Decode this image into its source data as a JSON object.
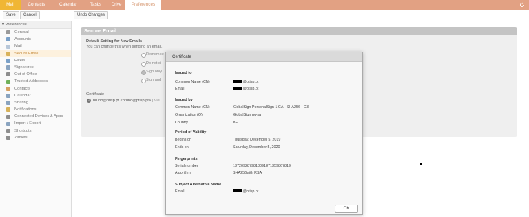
{
  "tabs": [
    {
      "label": "Mail"
    },
    {
      "label": "Contacts"
    },
    {
      "label": "Calendar"
    },
    {
      "label": "Tasks"
    },
    {
      "label": "Drive"
    },
    {
      "label": "Preferences"
    }
  ],
  "toolbar": {
    "save_label": "Save",
    "cancel_label": "Cancel",
    "undo_label": "Undo Changes"
  },
  "sidebar": {
    "header": "Preferences",
    "items": [
      {
        "label": "General",
        "icon": "gear-icon",
        "color": "#9a9a9a"
      },
      {
        "label": "Accounts",
        "icon": "accounts-icon",
        "color": "#7aa0c8"
      },
      {
        "label": "Mail",
        "icon": "mail-icon",
        "color": "#b7c7d9"
      },
      {
        "label": "Secure Email",
        "icon": "secure-email-icon",
        "color": "#d9b25a"
      },
      {
        "label": "Filters",
        "icon": "filters-icon",
        "color": "#7aa0c8"
      },
      {
        "label": "Signatures",
        "icon": "signatures-icon",
        "color": "#8aa4c0"
      },
      {
        "label": "Out of Office",
        "icon": "out-of-office-icon",
        "color": "#8e8e8e"
      },
      {
        "label": "Trusted Addresses",
        "icon": "trusted-addresses-icon",
        "color": "#6fb05a"
      },
      {
        "label": "Contacts",
        "icon": "contacts-icon",
        "color": "#d7a163"
      },
      {
        "label": "Calendar",
        "icon": "calendar-icon",
        "color": "#8aa4c0"
      },
      {
        "label": "Sharing",
        "icon": "sharing-icon",
        "color": "#8aa4c0"
      },
      {
        "label": "Notifications",
        "icon": "notifications-icon",
        "color": "#d7b25a"
      },
      {
        "label": "Connected Devices & Apps",
        "icon": "devices-icon",
        "color": "#8e8e8e"
      },
      {
        "label": "Import / Export",
        "icon": "import-export-icon",
        "color": "#8aa4c0"
      },
      {
        "label": "Shortcuts",
        "icon": "shortcuts-icon",
        "color": "#8e8e8e"
      },
      {
        "label": "Zimlets",
        "icon": "zimlets-icon",
        "color": "#8e8e8e"
      }
    ]
  },
  "secure_email": {
    "title": "Secure Email",
    "default_heading": "Default Setting for New Emails",
    "default_desc": "You can change this when sending an email.",
    "options": [
      {
        "label": "Remembe"
      },
      {
        "label": "Do not si"
      },
      {
        "label": "Sign only"
      },
      {
        "label": "Sign and"
      }
    ],
    "certificate_label": "Certificate",
    "certificate_value": "bruno@ptisp.pt <bruno@ptisp.pt>",
    "view_link": "| Vie"
  },
  "dialog": {
    "title": "Certificate",
    "issued_to": {
      "heading": "Issued to",
      "cn_label": "Common Name (CN)",
      "cn_value": "@ptisp.pt",
      "email_label": "Email",
      "email_value": "@ptisp.pt"
    },
    "issued_by": {
      "heading": "Issued by",
      "cn_label": "Common Name (CN)",
      "cn_value": "GlobalSign PersonalSign 1 CA - SHA256 - G3",
      "org_label": "Organization (O)",
      "org_value": "GlobalSign nv-sa",
      "country_label": "Country",
      "country_value": "BE"
    },
    "validity": {
      "heading": "Period of Validity",
      "begins_label": "Begins on",
      "begins_value": "Thursday, December 5, 2019",
      "ends_label": "Ends on",
      "ends_value": "Saturday, December 5, 2020"
    },
    "fingerprints": {
      "heading": "Fingerprints",
      "serial_label": "Serial number",
      "serial_value": "1372092879818091871359867819",
      "algo_label": "Algorithm",
      "algo_value": "SHA256with RSA"
    },
    "san": {
      "heading": "Subject Alternative Name",
      "email_label": "Email",
      "email_value": "@ptisp.pt"
    },
    "ok_label": "OK"
  }
}
